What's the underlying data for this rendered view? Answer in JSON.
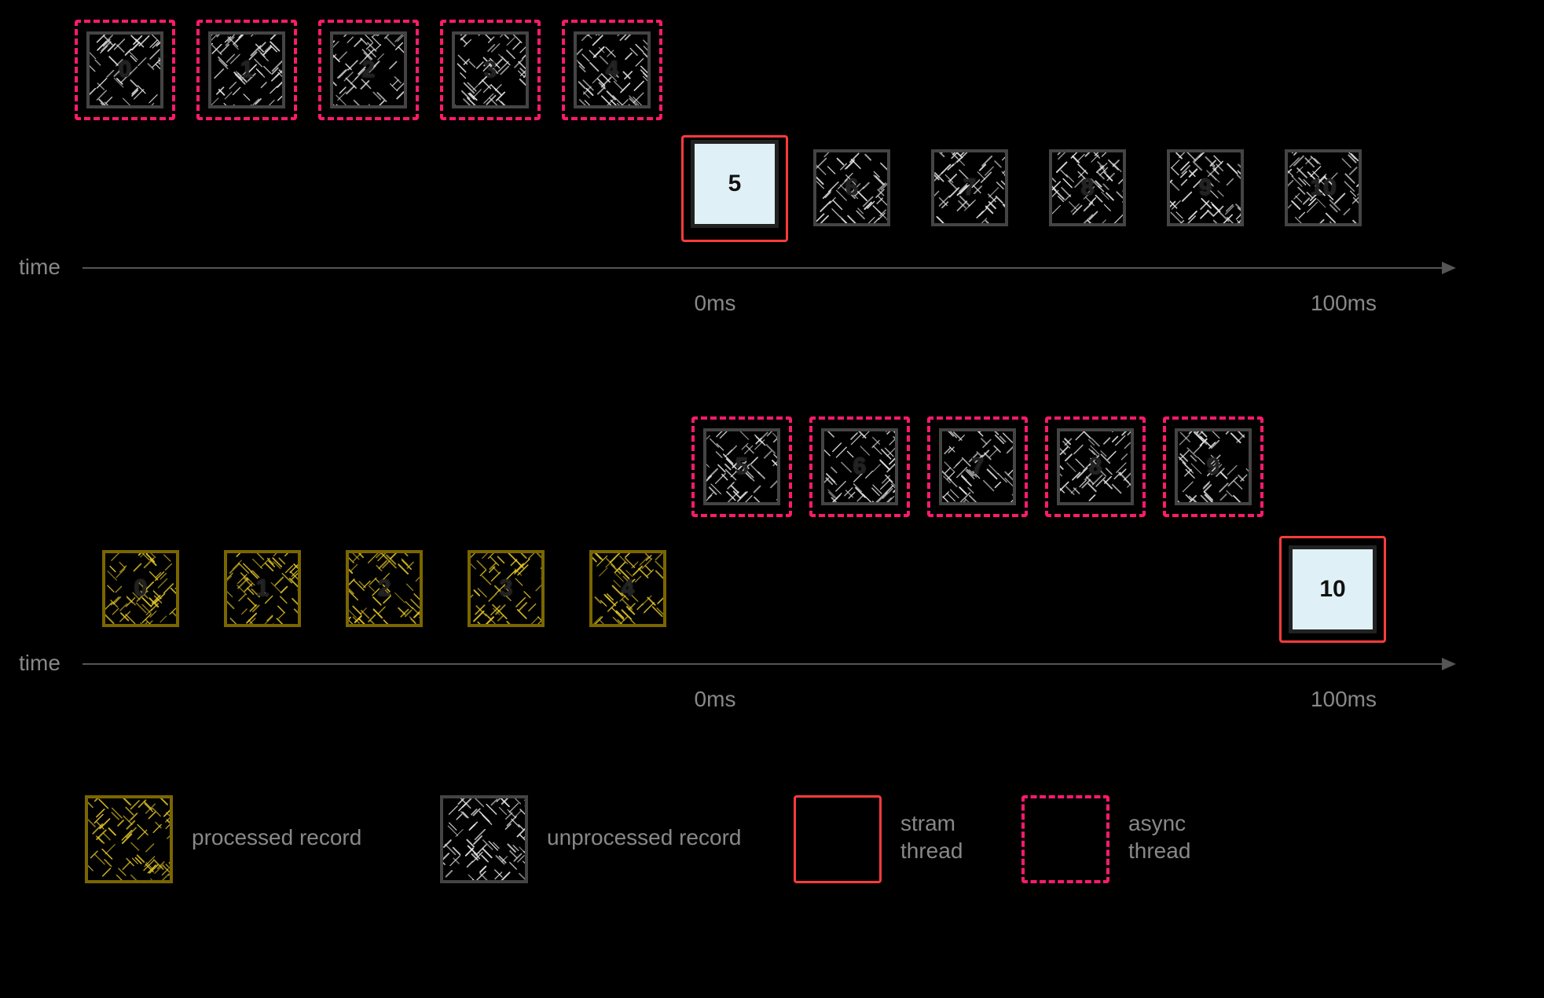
{
  "axis_label": "time",
  "ticks": {
    "zero": "0ms",
    "hundred": "100ms"
  },
  "top_async_row": {
    "labels": [
      "0",
      "1",
      "2",
      "3",
      "4"
    ]
  },
  "top_queue_row": {
    "labels": [
      "5",
      "6",
      "7",
      "8",
      "9",
      "10"
    ],
    "stream_index": 0
  },
  "bot_async_row": {
    "labels": [
      "5",
      "6",
      "7",
      "8",
      "9"
    ]
  },
  "bot_done_row": {
    "labels": [
      "0",
      "1",
      "2",
      "3",
      "4"
    ]
  },
  "bot_queue_row": {
    "labels": [
      "10"
    ],
    "stream_index": 0
  },
  "legend": {
    "processed": "processed record",
    "unprocessed": "unprocessed record",
    "stream": "stram\nthread",
    "async": "async\nthread"
  },
  "colors": {
    "unprocessed_fg": "#e8e8e8",
    "processed_fg": "#e6c82a",
    "current_bg": "#dff1f6",
    "stream_border": "#ff3b3b",
    "async_border": "#ff1b6b"
  }
}
